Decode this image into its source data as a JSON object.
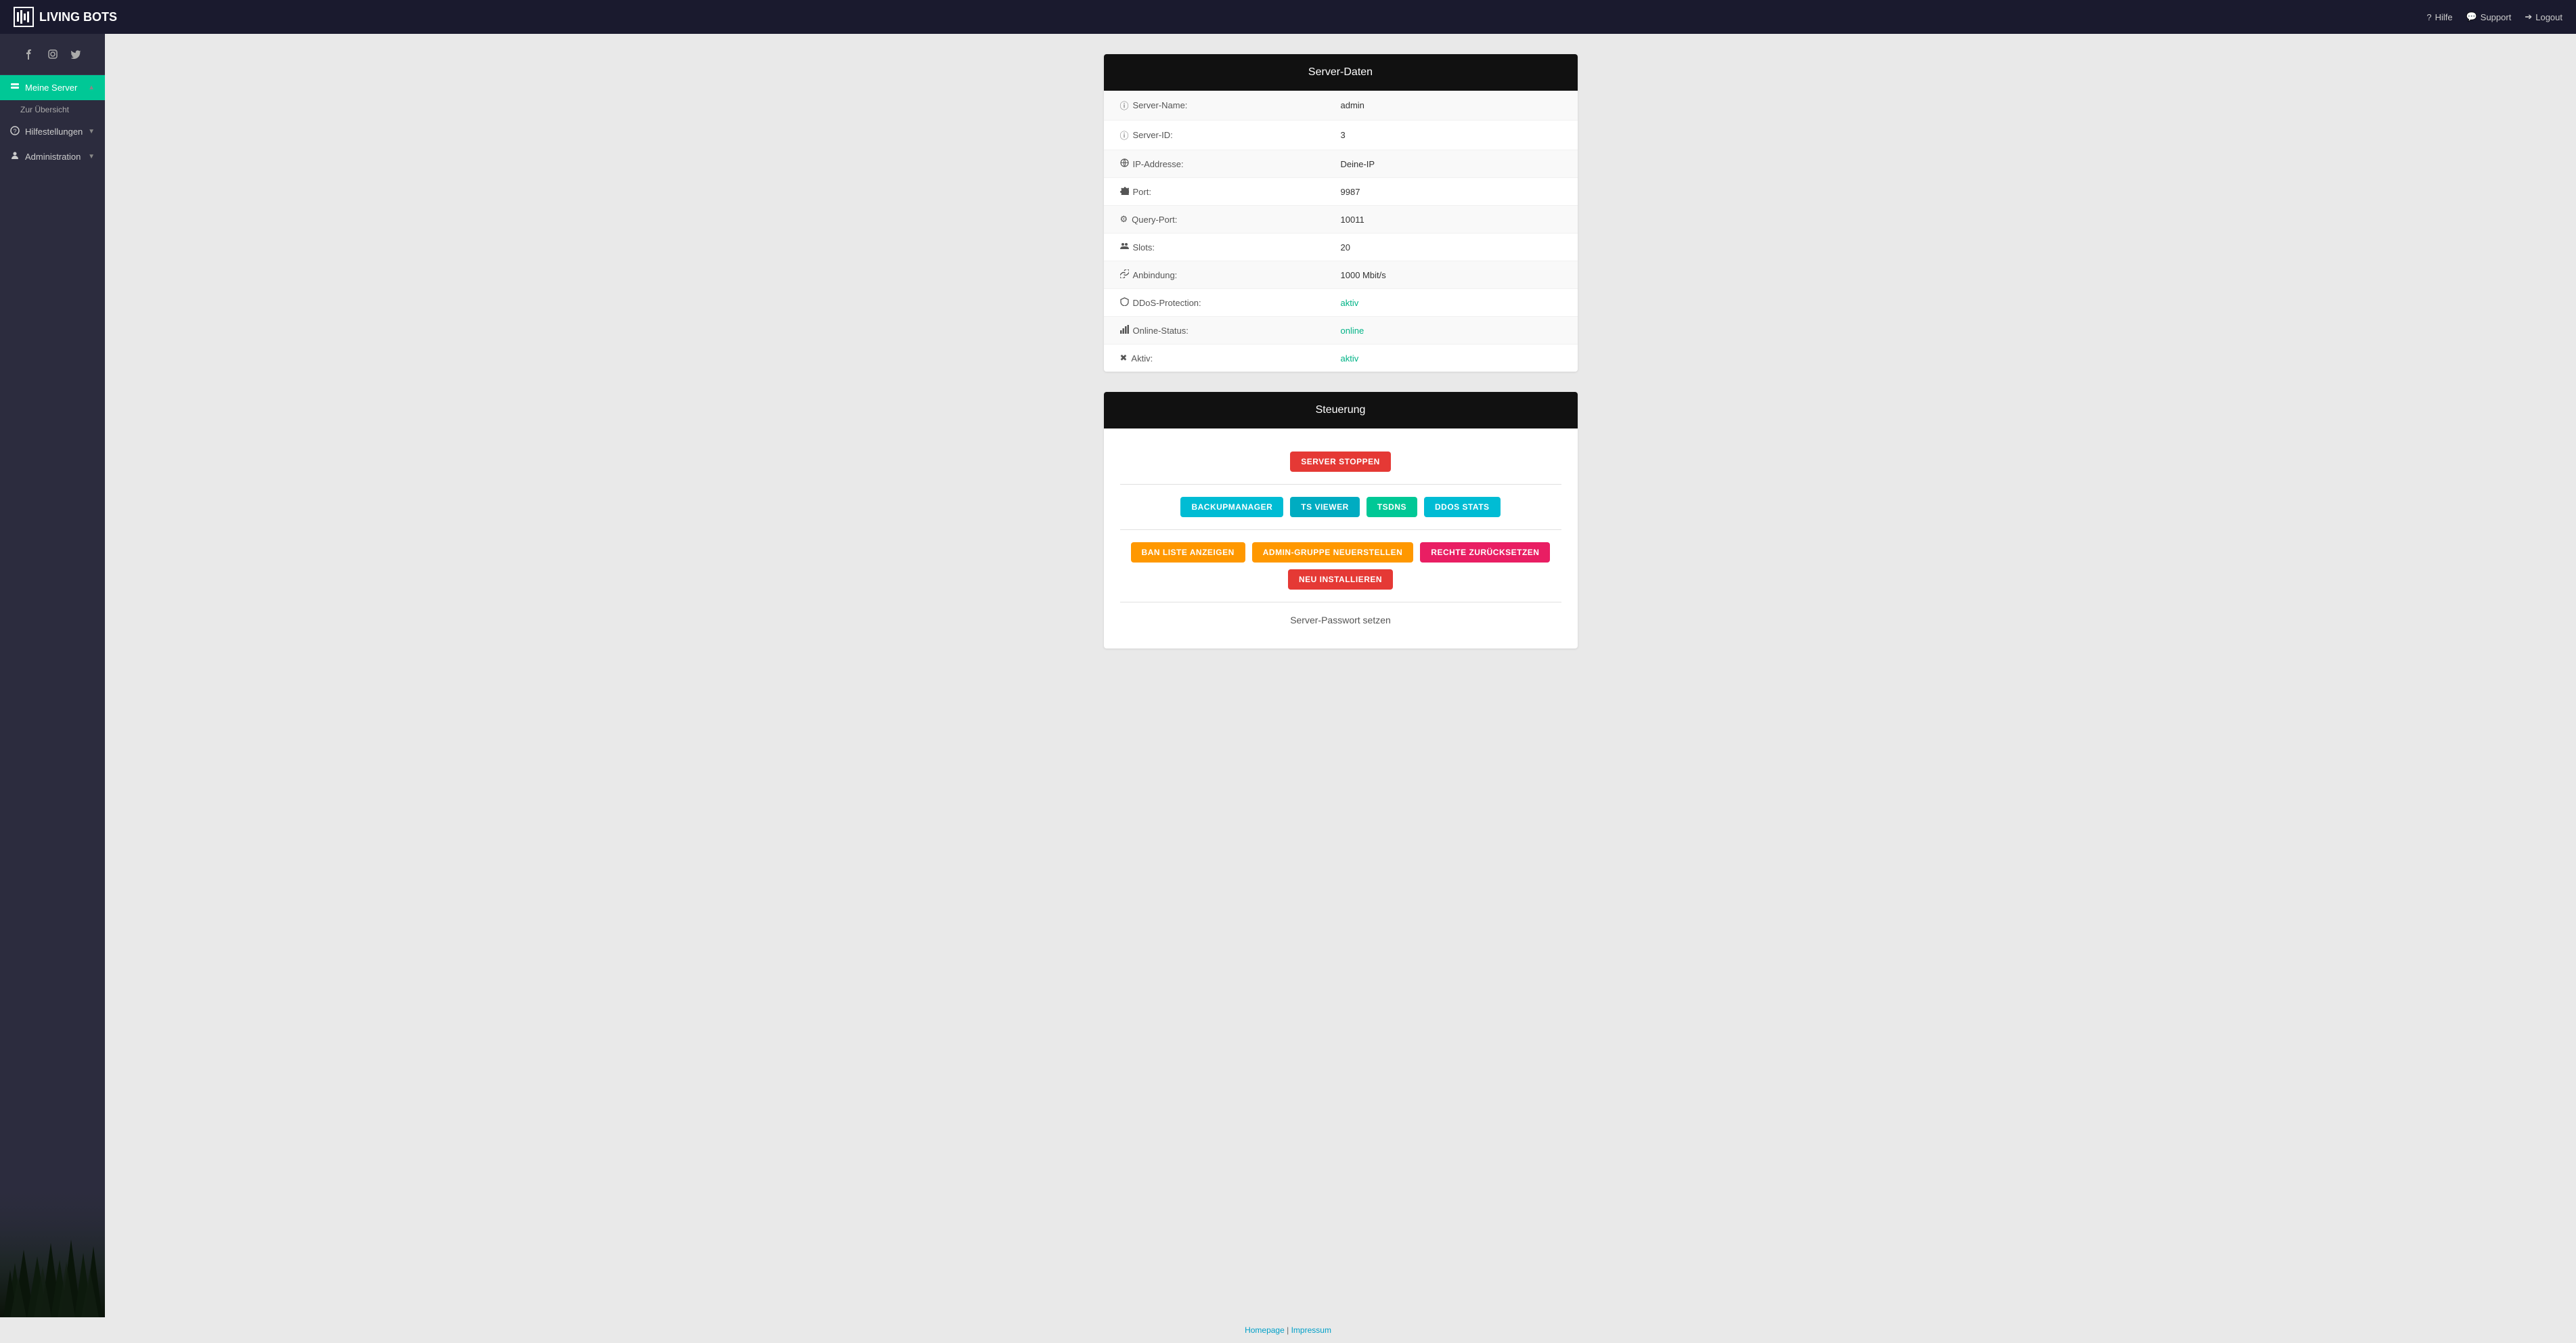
{
  "topbar": {
    "logo_text": "LIVING BOTS",
    "help_label": "Hilfe",
    "support_label": "Support",
    "logout_label": "Logout"
  },
  "sidebar": {
    "social": [
      {
        "name": "facebook-icon",
        "symbol": "f"
      },
      {
        "name": "instagram-icon",
        "symbol": "ig"
      },
      {
        "name": "twitter-icon",
        "symbol": "t"
      }
    ],
    "nav": [
      {
        "id": "meine-server",
        "label": "Meine Server",
        "active": true,
        "icon": "server-icon",
        "has_chevron": true,
        "sub_items": [
          {
            "label": "Zur Übersicht",
            "id": "zur-ubersicht"
          }
        ]
      },
      {
        "id": "hilfestellungen",
        "label": "Hilfestellungen",
        "active": false,
        "icon": "help-icon",
        "has_chevron": true,
        "sub_items": []
      },
      {
        "id": "administration",
        "label": "Administration",
        "active": false,
        "icon": "admin-icon",
        "has_chevron": true,
        "sub_items": []
      }
    ]
  },
  "server_daten": {
    "title": "Server-Daten",
    "rows": [
      {
        "label": "Server-Name:",
        "value": "admin",
        "icon": "info-icon",
        "value_class": ""
      },
      {
        "label": "Server-ID:",
        "value": "3",
        "icon": "info-icon",
        "value_class": ""
      },
      {
        "label": "IP-Addresse:",
        "value": "Deine-IP",
        "icon": "network-icon",
        "value_class": ""
      },
      {
        "label": "Port:",
        "value": "9987",
        "icon": "settings-icon",
        "value_class": ""
      },
      {
        "label": "Query-Port:",
        "value": "10011",
        "icon": "settings-icon",
        "value_class": ""
      },
      {
        "label": "Slots:",
        "value": "20",
        "icon": "users-icon",
        "value_class": ""
      },
      {
        "label": "Anbindung:",
        "value": "1000 Mbit/s",
        "icon": "link-icon",
        "value_class": ""
      },
      {
        "label": "DDoS-Protection:",
        "value": "aktiv",
        "icon": "shield-icon",
        "value_class": "green"
      },
      {
        "label": "Online-Status:",
        "value": "online",
        "icon": "signal-icon",
        "value_class": "green"
      },
      {
        "label": "Aktiv:",
        "value": "aktiv",
        "icon": "cog-icon",
        "value_class": "green"
      }
    ]
  },
  "steuerung": {
    "title": "Steuerung",
    "stop_btn": "SERVER STOPPEN",
    "tool_buttons": [
      {
        "label": "BACKUPMANAGER",
        "class": "btn-cyan"
      },
      {
        "label": "TS VIEWER",
        "class": "btn-teal"
      },
      {
        "label": "TSDNS",
        "class": "btn-green"
      },
      {
        "label": "DDOS STATS",
        "class": "btn-cyan"
      }
    ],
    "action_buttons": [
      {
        "label": "BAN LISTE ANZEIGEN",
        "class": "btn-orange"
      },
      {
        "label": "ADMIN-GRUPPE NEUERSTELLEN",
        "class": "btn-orange"
      },
      {
        "label": "RECHTE ZURÜCKSETZEN",
        "class": "btn-pink"
      },
      {
        "label": "NEU INSTALLIEREN",
        "class": "btn-red"
      }
    ],
    "password_section_title": "Server-Passwort setzen"
  },
  "footer": {
    "homepage_label": "Homepage",
    "impressum_label": "Impressum",
    "separator": "|"
  }
}
